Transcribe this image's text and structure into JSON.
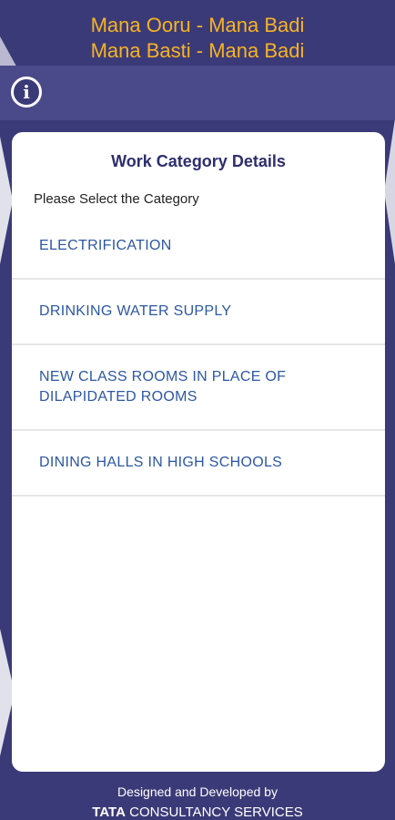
{
  "header": {
    "line1": "Mana Ooru - Mana Badi",
    "line2": "Mana Basti - Mana Badi"
  },
  "info": {
    "glyph": "i"
  },
  "card": {
    "title": "Work Category Details",
    "subtitle": "Please Select the Category",
    "categories": [
      "ELECTRIFICATION",
      "DRINKING WATER SUPPLY",
      "NEW CLASS ROOMS IN PLACE OF DILAPIDATED ROOMS",
      "DINING HALLS IN HIGH SCHOOLS"
    ]
  },
  "footer": {
    "line1": "Designed and Developed by",
    "brand": "TATA",
    "company": "CONSULTANCY SERVICES"
  },
  "colors": {
    "background": "#3b3a78",
    "header_text": "#f6b323",
    "link_text": "#2c57a3"
  }
}
